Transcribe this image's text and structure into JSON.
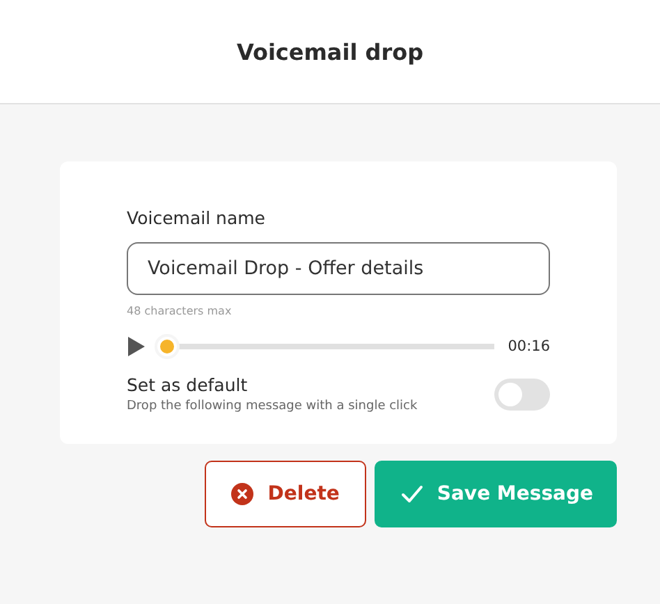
{
  "header": {
    "title": "Voicemail drop"
  },
  "name_field": {
    "label": "Voicemail name",
    "value": "Voicemail Drop - Offer details",
    "hint": "48 characters max"
  },
  "player": {
    "level": 0.0,
    "time": "00:16"
  },
  "default_setting": {
    "label": "Set as default",
    "description": "Drop the following message with a single click",
    "on": false
  },
  "buttons": [
    {
      "kind": "delete",
      "label": "Delete"
    },
    {
      "kind": "save",
      "label": "Save Message"
    }
  ]
}
